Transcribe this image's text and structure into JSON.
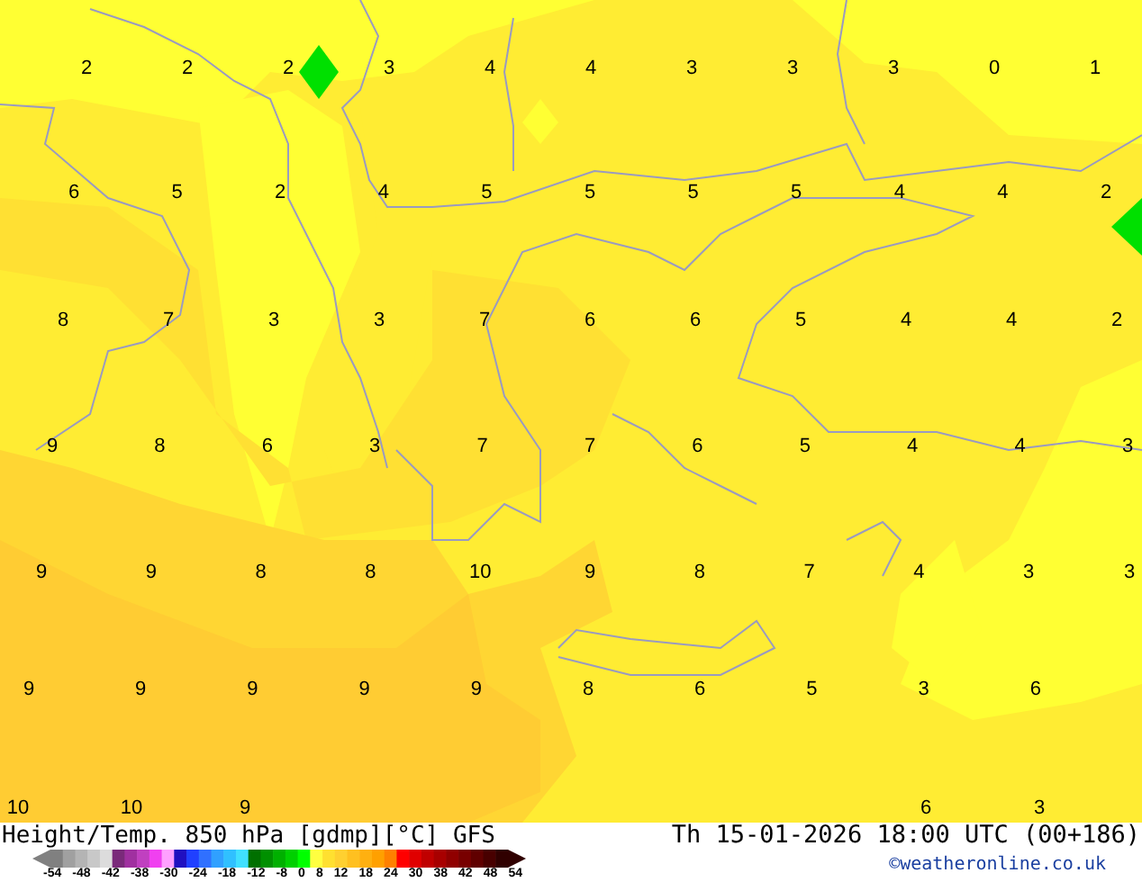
{
  "map": {
    "rows": [
      [
        "2",
        "2",
        "2",
        "3",
        "4",
        "4",
        "3",
        "3",
        "3",
        "0",
        "1"
      ],
      [
        "6",
        "5",
        "2",
        "4",
        "5",
        "5",
        "5",
        "5",
        "4",
        "4",
        "2"
      ],
      [
        "8",
        "7",
        "3",
        "3",
        "7",
        "6",
        "6",
        "5",
        "4",
        "4",
        "2"
      ],
      [
        "9",
        "8",
        "6",
        "3",
        "7",
        "7",
        "6",
        "5",
        "4",
        "4",
        "3"
      ],
      [
        "9",
        "9",
        "8",
        "8",
        "10",
        "9",
        "8",
        "7",
        "4",
        "3",
        "3"
      ],
      [
        "9",
        "9",
        "9",
        "9",
        "9",
        "8",
        "6",
        "5",
        "3",
        "6"
      ],
      [
        "10",
        "10",
        "9",
        null,
        null,
        null,
        null,
        null,
        "6",
        "3"
      ]
    ]
  },
  "title": "Height/Temp. 850 hPa [gdmp][°C] GFS",
  "valid_time": "Th 15-01-2026 18:00 UTC (00+186)",
  "credit": "©weatheronline.co.uk",
  "legend": {
    "swatches": [
      {
        "color": "#808080"
      },
      {
        "color": "#a0a0a0"
      },
      {
        "color": "#b4b4b4"
      },
      {
        "color": "#c8c8c8"
      },
      {
        "color": "#dcdcdc"
      },
      {
        "color": "#7a2a7a"
      },
      {
        "color": "#a030a0"
      },
      {
        "color": "#c040c0"
      },
      {
        "color": "#f040f0"
      },
      {
        "color": "#ffa0ff"
      },
      {
        "color": "#2010c0"
      },
      {
        "color": "#2040ff"
      },
      {
        "color": "#3070ff"
      },
      {
        "color": "#30a0ff"
      },
      {
        "color": "#30c0ff"
      },
      {
        "color": "#40e0ff"
      },
      {
        "color": "#007000"
      },
      {
        "color": "#009000"
      },
      {
        "color": "#00b000"
      },
      {
        "color": "#00d000"
      },
      {
        "color": "#00ff00"
      },
      {
        "color": "#ffff40"
      },
      {
        "color": "#ffe030"
      },
      {
        "color": "#ffd030"
      },
      {
        "color": "#ffc020"
      },
      {
        "color": "#ffb010"
      },
      {
        "color": "#ffa000"
      },
      {
        "color": "#ff8000"
      },
      {
        "color": "#ff0000"
      },
      {
        "color": "#e00000"
      },
      {
        "color": "#c00000"
      },
      {
        "color": "#a80000"
      },
      {
        "color": "#900000"
      },
      {
        "color": "#780000"
      },
      {
        "color": "#600000"
      },
      {
        "color": "#480000"
      },
      {
        "color": "#300000"
      }
    ],
    "ticks": [
      "-54",
      "-48",
      "-42",
      "-38",
      "-30",
      "-24",
      "-18",
      "-12",
      "-8",
      "0",
      "8",
      "12",
      "18",
      "24",
      "30",
      "38",
      "42",
      "48",
      "54"
    ]
  }
}
